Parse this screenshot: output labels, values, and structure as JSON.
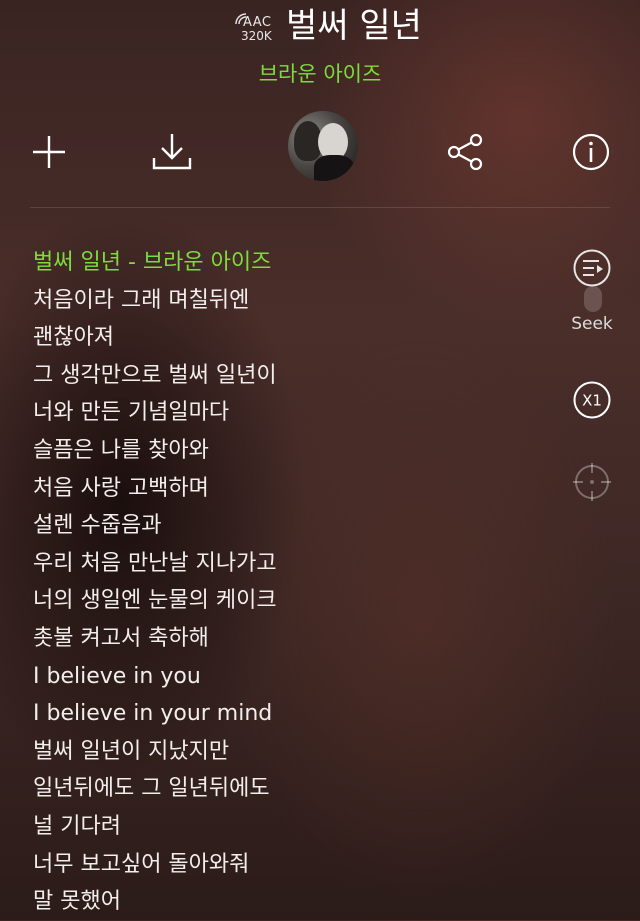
{
  "header": {
    "quality_codec": "AAC",
    "quality_bitrate": "320K",
    "title": "벌써 일년",
    "artist": "브라운 아이즈"
  },
  "toolbar": {
    "icons": [
      "add-icon",
      "download-icon",
      "album-art",
      "share-icon",
      "info-icon"
    ]
  },
  "lyrics": [
    "벌써 일년 - 브라운 아이즈",
    "처음이라 그래 며칠뒤엔",
    "괜찮아져",
    "그 생각만으로 벌써 일년이",
    "너와 만든 기념일마다",
    "슬픔은 나를 찾아와",
    "처음 사랑 고백하며",
    "설렌 수줍음과",
    "우리 처음 만난날 지나가고",
    "너의 생일엔 눈물의 케이크",
    "촛불 켜고서 축하해",
    "I believe in you",
    "I believe in your mind",
    "벌써 일년이 지났지만",
    "일년뒤에도 그 일년뒤에도",
    "널 기다려",
    "너무 보고싶어 돌아와줘",
    "말 못했어"
  ],
  "side": {
    "seek_label": "Seek",
    "speed_label": "X1"
  },
  "colors": {
    "accent": "#7ddc3c",
    "text": "#ffffff"
  }
}
